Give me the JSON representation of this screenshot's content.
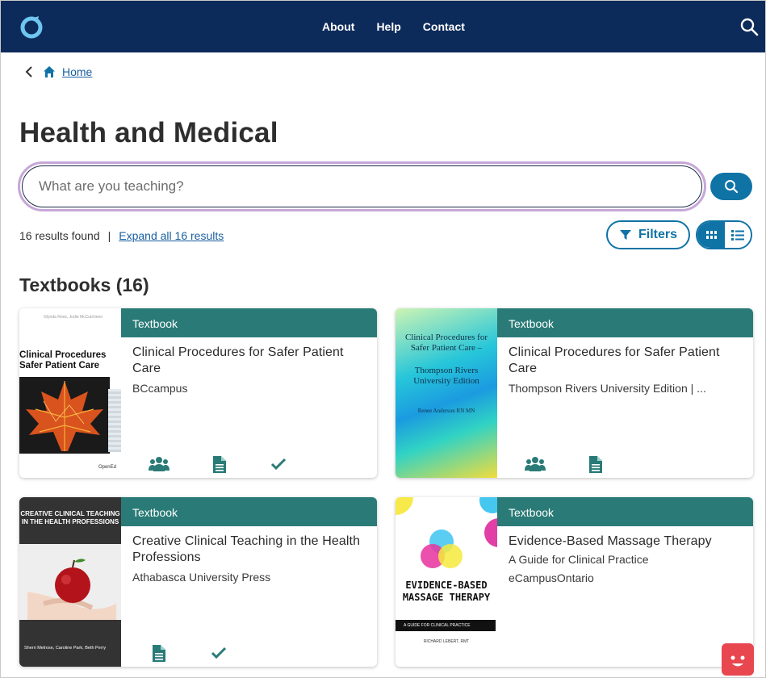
{
  "header": {
    "nav": [
      "About",
      "Help",
      "Contact"
    ]
  },
  "breadcrumb": {
    "home_label": "Home"
  },
  "page_title": "Health and Medical",
  "search": {
    "placeholder": "What are you teaching?",
    "value": ""
  },
  "results": {
    "count_text": "16 results found",
    "separator": "|",
    "expand_text": "Expand all 16 results"
  },
  "toolbar": {
    "filters_label": "Filters"
  },
  "section_title": "Textbooks (16)",
  "colors": {
    "header_bg": "#0d2b5a",
    "accent": "#0f73a6",
    "tag_bg": "#2a7b77",
    "search_focus": "#c6a7d8"
  },
  "cards": [
    {
      "tag": "Textbook",
      "title": "Clinical Procedures for Safer Patient Care",
      "lines": [
        "BCcampus"
      ],
      "icons": [
        "users-icon",
        "document-icon",
        "check-icon"
      ],
      "cover": {
        "author": "Glynda Rees, Jodie McCutcheon",
        "title": "Clinical Procedures Safer Patient Care",
        "footer": "OpenEd"
      }
    },
    {
      "tag": "Textbook",
      "title": "Clinical Procedures for Safer Patient Care",
      "lines": [
        "Thompson Rivers University Edition | ..."
      ],
      "icons": [
        "users-icon",
        "document-icon"
      ],
      "cover": {
        "title": "Clinical Procedures for Safer Patient Care –",
        "edition": "Thompson Rivers University Edition",
        "author": "Renee Anderson RN MN"
      }
    },
    {
      "tag": "Textbook",
      "title": "Creative Clinical Teaching in the Health Professions",
      "lines": [
        "Athabasca University Press"
      ],
      "icons": [
        "document-icon",
        "check-icon"
      ],
      "cover": {
        "title": "CREATIVE CLINICAL TEACHING IN THE HEALTH PROFESSIONS",
        "authors": "Sherri Melrose, Caroline Park, Beth Perry"
      }
    },
    {
      "tag": "Textbook",
      "title": "Evidence-Based Massage Therapy",
      "lines": [
        "A Guide for Clinical Practice",
        "eCampusOntario"
      ],
      "icons": [],
      "cover": {
        "title": "EVIDENCE-BASED MASSAGE THERAPY",
        "subtitle": "A GUIDE FOR CLINICAL PRACTICE",
        "author": "RICHARD LEBERT, RMT"
      }
    }
  ]
}
